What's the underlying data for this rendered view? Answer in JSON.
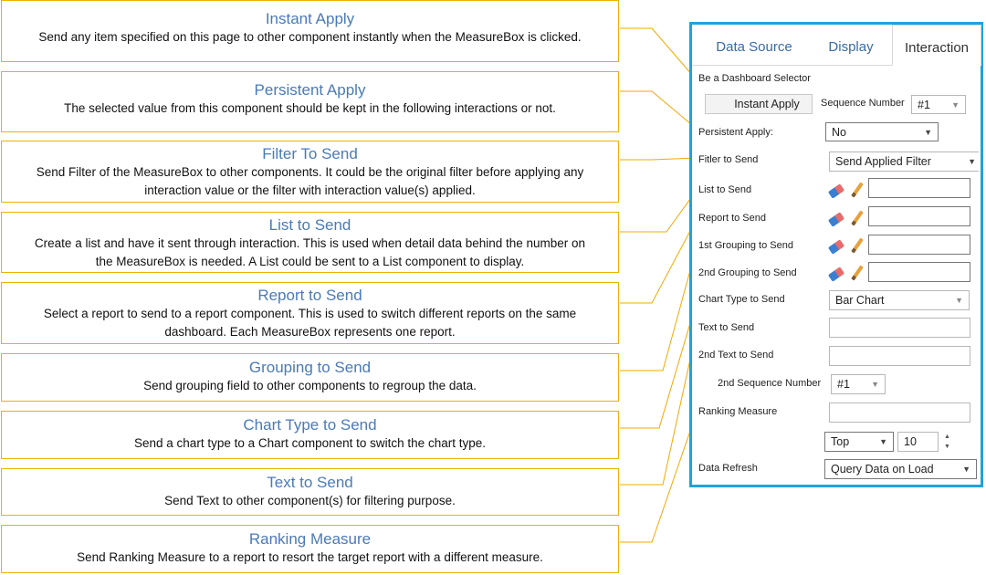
{
  "callouts": [
    {
      "title": "Instant Apply",
      "desc": [
        "Send any item specified on this page to other component instantly when the MeasureBox is clicked."
      ]
    },
    {
      "title": "Persistent Apply",
      "desc": [
        "The selected value from this component should be kept in the following interactions or not."
      ]
    },
    {
      "title": "Filter To Send",
      "desc": [
        "Send Filter of the MeasureBox to other components. It could be the original filter before applying any",
        "interaction value or the filter with interaction value(s) applied."
      ]
    },
    {
      "title": "List to Send",
      "desc": [
        "Create a list and have it sent through interaction. This is used when detail data behind the number on",
        "the MeasureBox is needed. A List could be sent to a List component to display."
      ]
    },
    {
      "title": "Report to Send",
      "desc": [
        "Select a report to send to a report component. This is used to switch different reports on the same",
        "dashboard. Each MeasureBox represents one report."
      ]
    },
    {
      "title": "Grouping to Send",
      "desc": [
        "Send grouping field to other components to regroup the data."
      ]
    },
    {
      "title": "Chart Type to Send",
      "desc": [
        "Send a chart type to a Chart component to switch the chart type."
      ]
    },
    {
      "title": "Text to Send",
      "desc": [
        "Send Text to other component(s) for filtering purpose."
      ]
    },
    {
      "title": "Ranking Measure",
      "desc": [
        "Send Ranking Measure to a report to resort the target report with a different measure."
      ]
    }
  ],
  "panel": {
    "tabs": [
      "Data Source",
      "Display",
      "Interaction"
    ],
    "active_tab": "Interaction",
    "dashboard_selector_label": "Be a Dashboard Selector",
    "instant_apply_label": "Instant Apply",
    "sequence_number_label": "Sequence Number",
    "sequence_number_value": "#1",
    "persistent_apply_label": "Persistent Apply:",
    "persistent_apply_value": "No",
    "filter_to_send_label": "Fitler to Send",
    "filter_to_send_value": "Send Applied Filter",
    "list_to_send_label": "List to Send",
    "report_to_send_label": "Report to Send",
    "grouping1_label": "1st Grouping to Send",
    "grouping2_label": "2nd Grouping to Send",
    "chart_type_label": "Chart Type to Send",
    "chart_type_value": "Bar Chart",
    "text_to_send_label": "Text to Send",
    "text2_to_send_label": "2nd Text to Send",
    "seq2_label": "2nd Sequence Number",
    "seq2_value": "#1",
    "ranking_measure_label": "Ranking Measure",
    "top_value": "Top",
    "count_value": "10",
    "data_refresh_label": "Data Refresh",
    "data_refresh_value": "Query Data on Load"
  },
  "colors": {
    "accent": "#1ea3dd",
    "callout_border": "#e8b400",
    "title": "#4a7ab8",
    "bullet": "#f5a800"
  }
}
